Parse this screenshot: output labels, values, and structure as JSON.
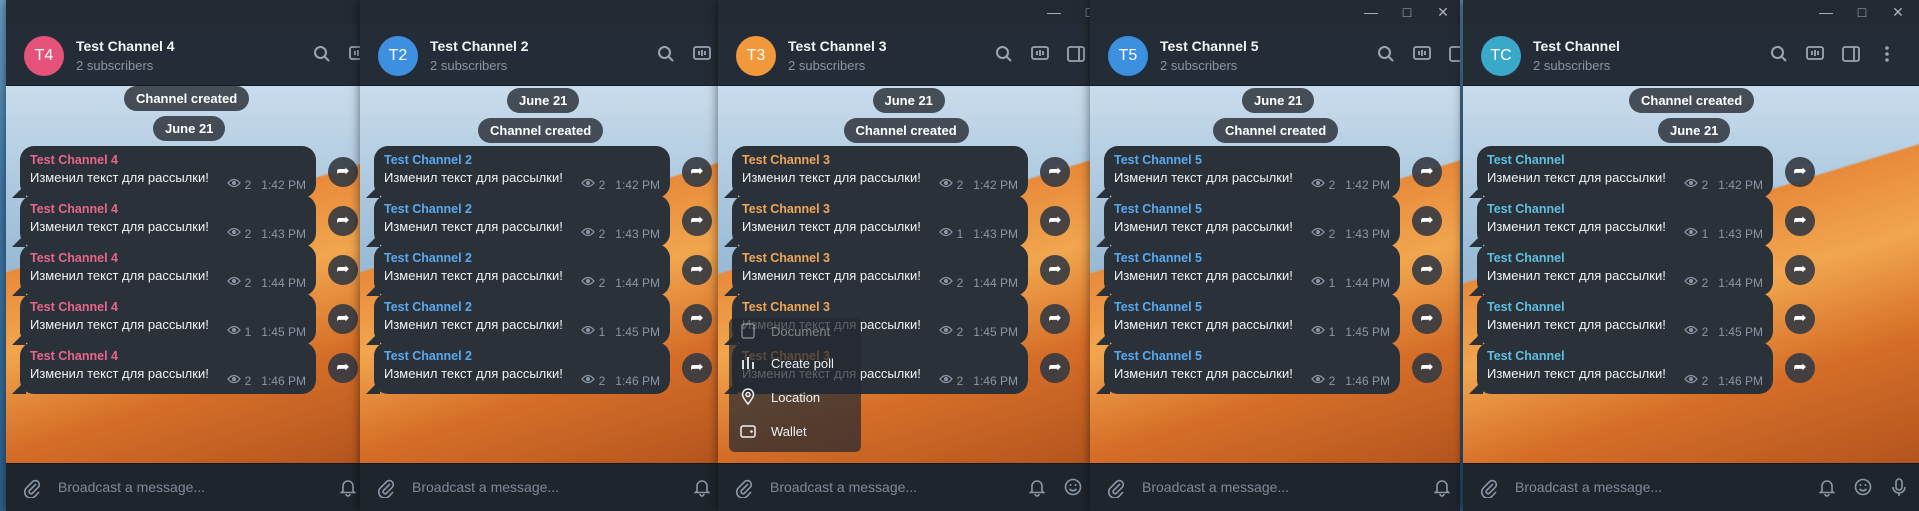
{
  "message_text": "Изменил текст для рассылки!",
  "placeholder": "Broadcast a message...",
  "subscribers": "2 subscribers",
  "date_label": "June 21",
  "created_label": "Channel created",
  "windows": [
    {
      "title": "Test Channel 4",
      "initials": "T4",
      "avatar_color": "#e6537a",
      "name_color": "#e7668c",
      "times": [
        "1:42 PM",
        "1:43 PM",
        "1:44 PM",
        "1:45 PM",
        "1:46 PM"
      ],
      "views": [
        "2",
        "2",
        "2",
        "1",
        "2"
      ]
    },
    {
      "title": "Test Channel 2",
      "initials": "T2",
      "avatar_color": "#3d8fe0",
      "name_color": "#59a9ef",
      "times": [
        "1:42 PM",
        "1:43 PM",
        "1:44 PM",
        "1:45 PM",
        "1:46 PM"
      ],
      "views": [
        "2",
        "2",
        "2",
        "1",
        "2"
      ]
    },
    {
      "title": "Test Channel 3",
      "initials": "T3",
      "avatar_color": "#f0983a",
      "name_color": "#eea65a",
      "times": [
        "1:42 PM",
        "1:43 PM",
        "1:44 PM",
        "1:45 PM",
        "1:46 PM"
      ],
      "views": [
        "2",
        "1",
        "2",
        "2",
        "2"
      ]
    },
    {
      "title": "Test Channel 5",
      "initials": "T5",
      "avatar_color": "#3d8fe0",
      "name_color": "#59a9ef",
      "times": [
        "1:42 PM",
        "1:43 PM",
        "1:44 PM",
        "1:45 PM",
        "1:46 PM"
      ],
      "views": [
        "2",
        "2",
        "1",
        "1",
        "2"
      ]
    },
    {
      "title": "Test Channel",
      "initials": "TC",
      "avatar_color": "#3aa9c9",
      "name_color": "#5ec0e0",
      "times": [
        "1:42 PM",
        "1:43 PM",
        "1:44 PM",
        "1:45 PM",
        "1:46 PM"
      ],
      "views": [
        "2",
        "1",
        "2",
        "2",
        "2"
      ]
    }
  ],
  "attach_menu": {
    "partial_item": "Document",
    "items": [
      "Create poll",
      "Location",
      "Wallet"
    ]
  }
}
